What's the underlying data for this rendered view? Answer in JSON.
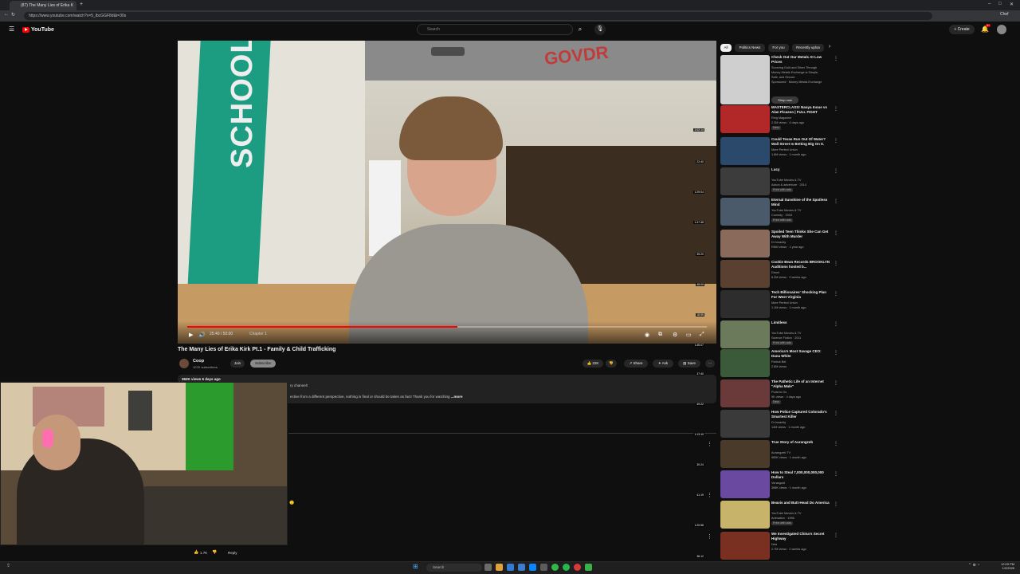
{
  "browser": {
    "tab_title": "(87) The Many Lies of Erika K",
    "url": "https://www.youtube.com/watch?v=5_lbcGGF8d&t=30s",
    "profile_label": "Chef"
  },
  "header": {
    "logo_text": "YouTube",
    "search_placeholder": "Search",
    "create_label": "Create",
    "notifications_badge": "9+"
  },
  "player": {
    "time_label": "25:40 / 50:00",
    "chapter_label": "Chapter 1",
    "poster_board_text": "SCHOOL",
    "banner_text": "GOVDR",
    "progress": 0.52
  },
  "video": {
    "title": "The Many Lies of Erika Kirk Pt.1 - Family & Child Trafficking",
    "channel_name": "Coop",
    "subscribers": "107K subscribers",
    "join_label": "Join",
    "subscribe_label": "Subscribe",
    "like_count": "22K",
    "share_label": "Share",
    "ask_label": "Ask",
    "save_label": "Save",
    "views_line": "362K views  6 days ago",
    "desc_line1": "ry channel!",
    "desc_line2": "ective from a different perspective, nothing is final or should be taken as fact! Thank you for watching",
    "more_label": "...more"
  },
  "comment": {
    "like_count": "1.7K",
    "reply_label": "Reply"
  },
  "chips": [
    "All",
    "Politics News",
    "For you",
    "Recently uploa"
  ],
  "recommendations": [
    {
      "title": "Check Out Our Metals At Low Prices",
      "line1": "Sourcing Gold and Silver Through",
      "line2": "Money Metals Exchange is Simple,",
      "line3": "Safe, and Secure.",
      "line4": "Sponsored · Money Metals Exchange",
      "color": "#cfcfcf",
      "dur": ""
    },
    {
      "title": "MASTERCLASS! Naoya Inoue vs Alan Picasso | FULL FIGHT",
      "line1": "Ring Magazine",
      "line2": "2.3M views · 4 days ago",
      "line3": "New",
      "line4": "",
      "color": "#b22828",
      "dur": "1:02:14"
    },
    {
      "title": "Could Texas Run Out Of Water? Wall Street Is Betting Big On It.",
      "line1": "More Perfect Union",
      "line2": "1.8M views · 1 month ago",
      "line3": "",
      "line4": "",
      "color": "#2b4a6b",
      "dur": "22:40"
    },
    {
      "title": "Lucy",
      "line1": "YouTube Movies & TV",
      "line2": "Action & adventure · 2014",
      "line3": "Free with ads",
      "line4": "",
      "color": "#3c3c3c",
      "dur": "1:29:04"
    },
    {
      "title": "Eternal Sunshine of the Spotless Mind",
      "line1": "YouTube Movies & TV",
      "line2": "Comedy · 2004",
      "line3": "Free with ads",
      "line4": "",
      "color": "#4a5a6a",
      "dur": "1:47:48"
    },
    {
      "title": "Spoiled Teen Thinks She Can Get Away With Murder",
      "line1": "Dr Insanity",
      "line2": "RNM views · 1 year ago",
      "line3": "",
      "line4": "",
      "color": "#8a6a5a",
      "dur": "35:20"
    },
    {
      "title": "Cookie Bean Records BROOKLYN Auditions hosted b...",
      "line1": "Drunk",
      "line2": "6.2M views · 2 weeks ago",
      "line3": "",
      "line4": "",
      "color": "#5a4030",
      "dur": "48:09"
    },
    {
      "title": "Tech Billionaires' Shocking Plan For West Virginia",
      "line1": "More Perfect Union",
      "line2": "1.1M views · 1 month ago",
      "line3": "",
      "line4": "",
      "color": "#2d2d2d",
      "dur": "18:55"
    },
    {
      "title": "Limitless",
      "line1": "YouTube Movies & TV",
      "line2": "Science Fiction · 2011",
      "line3": "Free with ads",
      "line4": "",
      "color": "#6a7a5a",
      "dur": "1:45:07"
    },
    {
      "title": "America's Most Savage CEO: Dana White",
      "line1": "Patrick Bet",
      "line2": "2.8M views",
      "line3": "",
      "line4": "",
      "color": "#3a5a3a",
      "dur": "37:40"
    },
    {
      "title": "The Pathetic Life of an Internet \"Alpha Male\"",
      "line1": "Pudd to Go",
      "line2": "9K views · 4 days ago",
      "line3": "New",
      "line4": "",
      "color": "#6a3a3a",
      "dur": "49:22"
    },
    {
      "title": "How Police Captured Colorado's Smartest Killer",
      "line1": "Dr Insanity",
      "line2": "14M views · 1 month ago",
      "line3": "",
      "line4": "",
      "color": "#3a3a3a",
      "dur": "1:13:10"
    },
    {
      "title": "True Story of Aurangzeb",
      "line1": "Aurangzeb TV",
      "line2": "960K views · 1 month ago",
      "line3": "",
      "line4": "",
      "color": "#4a3a2a",
      "dur": "30:24"
    },
    {
      "title": "How to Steal 7,000,000,000,000 Dollars",
      "line1": "Verasgoid",
      "line2": "368K views · 1 month ago",
      "line3": "",
      "line4": "",
      "color": "#6a4aa0",
      "dur": "41:19"
    },
    {
      "title": "Beavis and Butt-Head Do America",
      "line1": "YouTube Movies & TV",
      "line2": "Animation · 1996",
      "line3": "Free with ads",
      "line4": "",
      "color": "#c7b36a",
      "dur": "1:20:58"
    },
    {
      "title": "We Investigated China's Secret Highway",
      "line1": "Nea",
      "line2": "2.7M views · 2 weeks ago",
      "line3": "",
      "line4": "",
      "color": "#7a3020",
      "dur": "38:12"
    }
  ],
  "ad": {
    "button_label": "Shop now"
  },
  "taskbar": {
    "search_placeholder": "Search",
    "time": "12:09 PM",
    "date": "1/2/2026"
  },
  "colors": {
    "background": "#0f0f0f",
    "brand_red": "#ff0000",
    "subscribe_bg": "#8a8a8a"
  }
}
